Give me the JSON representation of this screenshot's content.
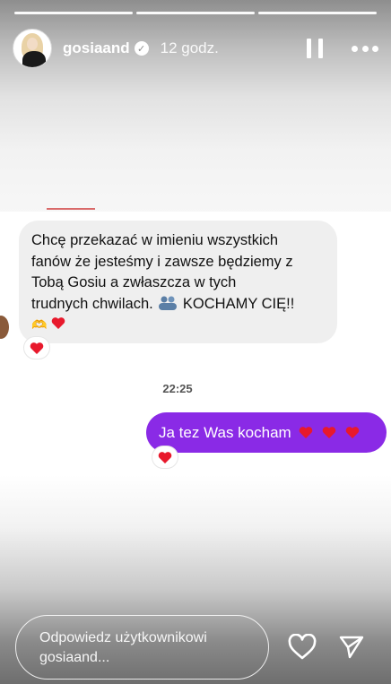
{
  "header": {
    "username": "gosiaand",
    "time_ago": "12 godz."
  },
  "message_in": {
    "text_line1": "Chcę przekazać w imieniu wszystkich",
    "text_line2": "fanów że jesteśmy i zawsze będziemy z",
    "text_line3": "Tobą Gosiu a zwłaszcza w tych",
    "text_line4_a": "trudnych chwilach.",
    "text_line4_b": "KOCHAMY CIĘ!!"
  },
  "timestamp": "22:25",
  "message_out": {
    "text": "Ja tez Was kocham"
  },
  "reply": {
    "placeholder_line1": "Odpowiedz użytkownikowi",
    "placeholder_line2": "gosiaand..."
  },
  "colors": {
    "outgoing_bubble": "#8a2ae6",
    "incoming_bubble": "#efefef",
    "heart": "#e8192c"
  },
  "icons": {
    "verified": "verified-badge-icon",
    "pause": "pause-icon",
    "more": "more-options-icon",
    "like": "heart-outline-icon",
    "send": "send-icon"
  }
}
